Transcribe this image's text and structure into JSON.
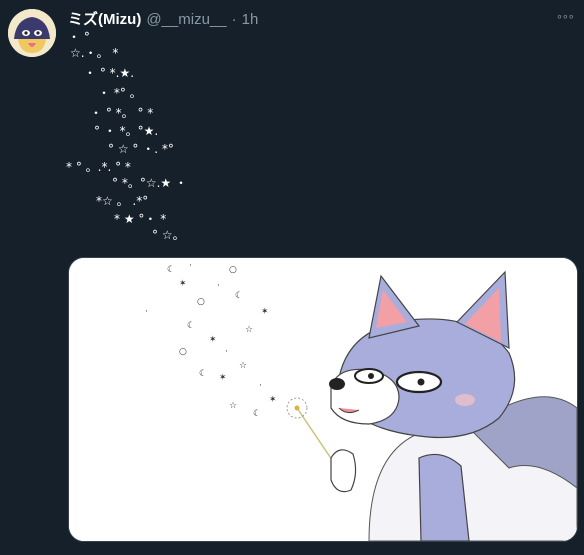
{
  "tweet": {
    "display_name": "ミズ(Mizu)",
    "handle": "@__mizu__",
    "separator": "·",
    "timestamp": "1h",
    "more_icon": "more-icon",
    "star_lines": [
      "・ °",
      "☆.・。 *",
      "・ ° *.★.",
      "・ *° 。",
      "・ ° *。 ° *",
      "° ・ *。°★.",
      "° ☆ ° ・. *°",
      "* ° 。.*. ° *",
      "° *。°☆.★ ・",
      "*☆ 。 .*°",
      "* ★ °・ *",
      "° ☆。"
    ]
  },
  "media": {
    "alt": "wolf-blowing-dandelion-illustration"
  },
  "colors": {
    "background": "#15202b",
    "secondary_text": "#8899a6",
    "border": "#38444d"
  }
}
